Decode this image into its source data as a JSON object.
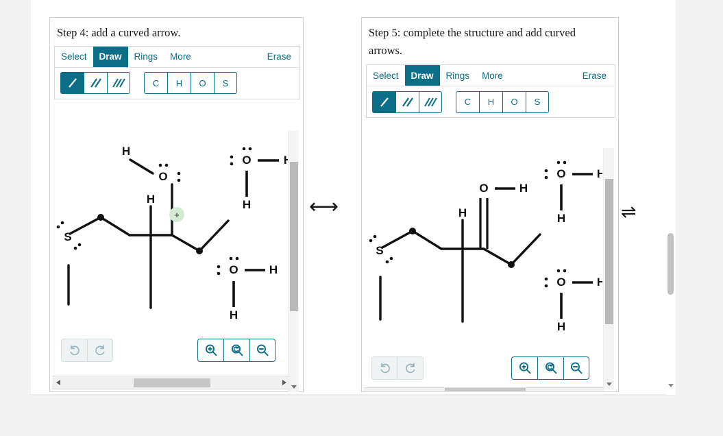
{
  "panels": [
    {
      "id": "step4",
      "title": "Step 4: add a curved arrow.",
      "toolbar": {
        "tabs": [
          {
            "label": "Select",
            "active": false
          },
          {
            "label": "Draw",
            "active": true
          },
          {
            "label": "Rings",
            "active": false
          },
          {
            "label": "More",
            "active": false
          }
        ],
        "erase_label": "Erase",
        "bond_tools": [
          {
            "name": "single-bond",
            "selected": true
          },
          {
            "name": "double-bond",
            "selected": false
          },
          {
            "name": "triple-bond",
            "selected": false
          }
        ],
        "element_tools": [
          {
            "label": "C"
          },
          {
            "label": "H"
          },
          {
            "label": "O"
          },
          {
            "label": "S"
          }
        ]
      },
      "bottom_tools": {
        "undo_label": "undo",
        "redo_label": "redo",
        "zoom_in_label": "zoom-in",
        "zoom_reset_label": "zoom-reset",
        "zoom_out_label": "zoom-out"
      },
      "molecule": {
        "description": "Protonated carbonyl cation with thiol chain and two water molecules",
        "atom_labels": [
          "H",
          "O",
          "H",
          "S",
          "O",
          "H",
          "H",
          "O",
          "H",
          "H"
        ],
        "charge_badge": "+",
        "charge_color": "#d5ead5"
      }
    },
    {
      "id": "step5",
      "title": "Step 5: complete the structure and add curved arrows.",
      "toolbar": {
        "tabs": [
          {
            "label": "Select",
            "active": false
          },
          {
            "label": "Draw",
            "active": true
          },
          {
            "label": "Rings",
            "active": false
          },
          {
            "label": "More",
            "active": false
          }
        ],
        "erase_label": "Erase",
        "bond_tools": [
          {
            "name": "single-bond",
            "selected": true
          },
          {
            "name": "double-bond",
            "selected": false
          },
          {
            "name": "triple-bond",
            "selected": false
          }
        ],
        "element_tools": [
          {
            "label": "C"
          },
          {
            "label": "H"
          },
          {
            "label": "O"
          },
          {
            "label": "S"
          }
        ]
      },
      "bottom_tools": {
        "undo_label": "undo",
        "redo_label": "redo",
        "zoom_in_label": "zoom-in",
        "zoom_reset_label": "zoom-reset",
        "zoom_out_label": "zoom-out"
      },
      "molecule": {
        "description": "Carbonyl with O-H, thiol chain and two water molecules",
        "atom_labels": [
          "O",
          "H",
          "H",
          "S",
          "O",
          "H",
          "H",
          "O",
          "H",
          "H"
        ]
      }
    }
  ],
  "connectors": {
    "resonance_arrow": "⟷",
    "equilibrium_arrow": "⇌"
  },
  "theme": {
    "accent": "#0d6e87",
    "accent_text": "#ffffff",
    "page_bg": "#f2f2f2",
    "panel_border": "#cfcfcf",
    "scroll_thumb": "#c2c2c2"
  }
}
